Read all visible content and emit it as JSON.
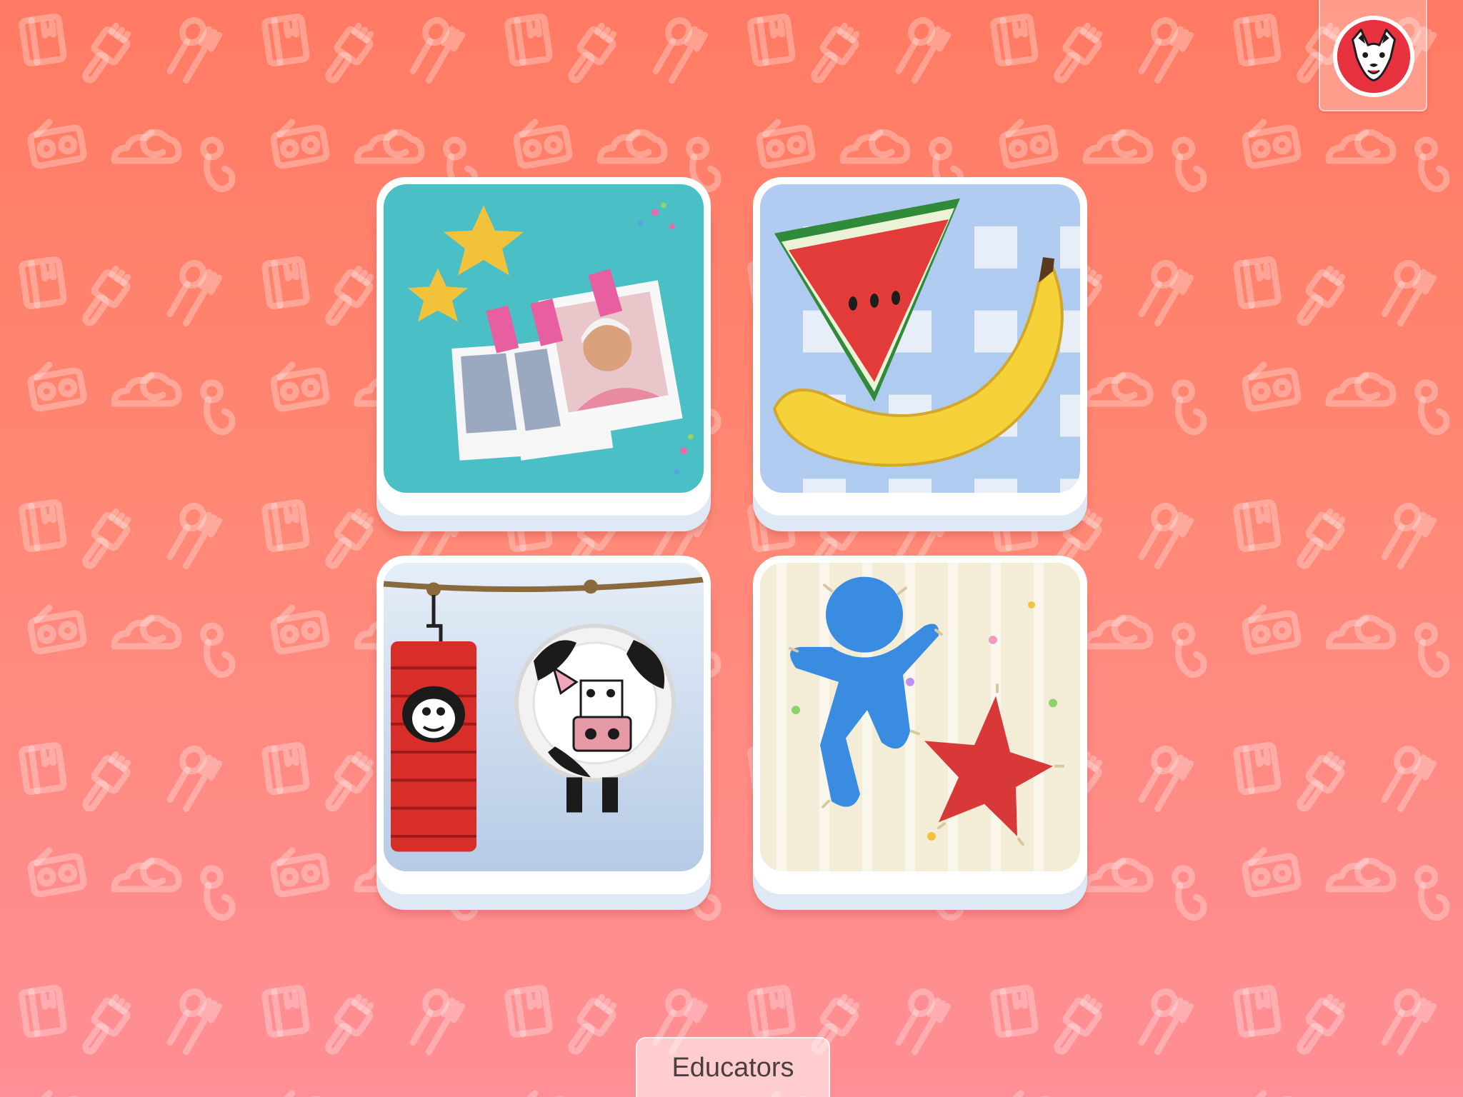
{
  "header": {
    "logo_icon": "fox-face-icon",
    "logo_color": "#e8313f"
  },
  "tiles": [
    {
      "id": "photos",
      "icon": "photo-album-icon"
    },
    {
      "id": "food",
      "icon": "watermelon-banana-icon"
    },
    {
      "id": "crafts",
      "icon": "paper-lantern-cow-plate-icon"
    },
    {
      "id": "stitch",
      "icon": "stitched-figure-star-icon"
    }
  ],
  "footer": {
    "educators_label": "Educators"
  },
  "colors": {
    "background_top": "#ff7a63",
    "background_bottom": "#ff8f96",
    "tile_frame": "#ffffff",
    "tile_base": "#dfe9f6"
  }
}
